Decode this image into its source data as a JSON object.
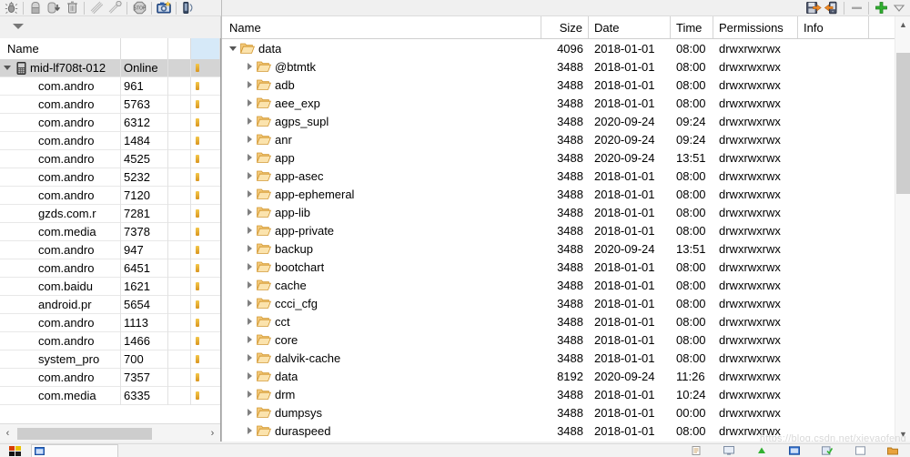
{
  "toolbar": {
    "left_buttons": [
      {
        "name": "debug-process-icon",
        "label": "Debug Process"
      },
      {
        "name": "update-heap-icon",
        "label": "Update Heap"
      },
      {
        "name": "dump-hprof-icon",
        "label": "Dump HPROF file"
      },
      {
        "name": "cause-gc-icon",
        "label": "Cause GC"
      },
      {
        "name": "update-threads-icon",
        "label": "Update Threads"
      },
      {
        "name": "start-method-profiling-icon",
        "label": "Start Method Profiling"
      },
      {
        "name": "stop-process-icon",
        "label": "Stop Process"
      },
      {
        "name": "screen-capture-icon",
        "label": "Screen Capture"
      },
      {
        "name": "device-panel-icon",
        "label": "Device Panel"
      }
    ],
    "right_buttons": [
      {
        "name": "pull-file-icon",
        "label": "Pull File from Device"
      },
      {
        "name": "push-file-icon",
        "label": "Push File onto Device"
      },
      {
        "name": "delete-icon",
        "label": "Delete"
      },
      {
        "name": "new-folder-icon",
        "label": "New Folder"
      },
      {
        "name": "view-menu-icon",
        "label": "View Menu"
      }
    ],
    "dropdown_name": "view-menu-caret"
  },
  "devices_panel": {
    "columns": [
      "Name",
      "",
      "",
      ""
    ],
    "device": {
      "name": "mid-lf708t-012",
      "status": "Online",
      "expanded": true
    },
    "processes": [
      {
        "name": "com.andro",
        "pid": "961"
      },
      {
        "name": "com.andro",
        "pid": "5763"
      },
      {
        "name": "com.andro",
        "pid": "6312"
      },
      {
        "name": "com.andro",
        "pid": "1484"
      },
      {
        "name": "com.andro",
        "pid": "4525"
      },
      {
        "name": "com.andro",
        "pid": "5232"
      },
      {
        "name": "com.andro",
        "pid": "7120"
      },
      {
        "name": "gzds.com.r",
        "pid": "7281"
      },
      {
        "name": "com.media",
        "pid": "7378"
      },
      {
        "name": "com.andro",
        "pid": "947"
      },
      {
        "name": "com.andro",
        "pid": "6451"
      },
      {
        "name": "com.baidu",
        "pid": "1621"
      },
      {
        "name": "android.pr",
        "pid": "5654"
      },
      {
        "name": "com.andro",
        "pid": "1113"
      },
      {
        "name": "com.andro",
        "pid": "1466"
      },
      {
        "name": "system_pro",
        "pid": "700"
      },
      {
        "name": "com.andro",
        "pid": "7357"
      },
      {
        "name": "com.media",
        "pid": "6335"
      }
    ],
    "hscrollbar": {
      "left_arrow": "‹",
      "right_arrow": "›"
    }
  },
  "file_explorer": {
    "columns": [
      "Name",
      "Size",
      "Date",
      "Time",
      "Permissions",
      "Info"
    ],
    "rows": [
      {
        "name": "data",
        "depth": 0,
        "expanded": true,
        "size": "4096",
        "date": "2018-01-01",
        "time": "08:00",
        "permissions": "drwxrwxrwx",
        "info": ""
      },
      {
        "name": "@btmtk",
        "depth": 1,
        "expanded": false,
        "size": "3488",
        "date": "2018-01-01",
        "time": "08:00",
        "permissions": "drwxrwxrwx",
        "info": ""
      },
      {
        "name": "adb",
        "depth": 1,
        "expanded": false,
        "size": "3488",
        "date": "2018-01-01",
        "time": "08:00",
        "permissions": "drwxrwxrwx",
        "info": ""
      },
      {
        "name": "aee_exp",
        "depth": 1,
        "expanded": false,
        "size": "3488",
        "date": "2018-01-01",
        "time": "08:00",
        "permissions": "drwxrwxrwx",
        "info": ""
      },
      {
        "name": "agps_supl",
        "depth": 1,
        "expanded": false,
        "size": "3488",
        "date": "2020-09-24",
        "time": "09:24",
        "permissions": "drwxrwxrwx",
        "info": ""
      },
      {
        "name": "anr",
        "depth": 1,
        "expanded": false,
        "size": "3488",
        "date": "2020-09-24",
        "time": "09:24",
        "permissions": "drwxrwxrwx",
        "info": ""
      },
      {
        "name": "app",
        "depth": 1,
        "expanded": false,
        "size": "3488",
        "date": "2020-09-24",
        "time": "13:51",
        "permissions": "drwxrwxrwx",
        "info": ""
      },
      {
        "name": "app-asec",
        "depth": 1,
        "expanded": false,
        "size": "3488",
        "date": "2018-01-01",
        "time": "08:00",
        "permissions": "drwxrwxrwx",
        "info": ""
      },
      {
        "name": "app-ephemeral",
        "depth": 1,
        "expanded": false,
        "size": "3488",
        "date": "2018-01-01",
        "time": "08:00",
        "permissions": "drwxrwxrwx",
        "info": ""
      },
      {
        "name": "app-lib",
        "depth": 1,
        "expanded": false,
        "size": "3488",
        "date": "2018-01-01",
        "time": "08:00",
        "permissions": "drwxrwxrwx",
        "info": ""
      },
      {
        "name": "app-private",
        "depth": 1,
        "expanded": false,
        "size": "3488",
        "date": "2018-01-01",
        "time": "08:00",
        "permissions": "drwxrwxrwx",
        "info": ""
      },
      {
        "name": "backup",
        "depth": 1,
        "expanded": false,
        "size": "3488",
        "date": "2020-09-24",
        "time": "13:51",
        "permissions": "drwxrwxrwx",
        "info": ""
      },
      {
        "name": "bootchart",
        "depth": 1,
        "expanded": false,
        "size": "3488",
        "date": "2018-01-01",
        "time": "08:00",
        "permissions": "drwxrwxrwx",
        "info": ""
      },
      {
        "name": "cache",
        "depth": 1,
        "expanded": false,
        "size": "3488",
        "date": "2018-01-01",
        "time": "08:00",
        "permissions": "drwxrwxrwx",
        "info": ""
      },
      {
        "name": "ccci_cfg",
        "depth": 1,
        "expanded": false,
        "size": "3488",
        "date": "2018-01-01",
        "time": "08:00",
        "permissions": "drwxrwxrwx",
        "info": ""
      },
      {
        "name": "cct",
        "depth": 1,
        "expanded": false,
        "size": "3488",
        "date": "2018-01-01",
        "time": "08:00",
        "permissions": "drwxrwxrwx",
        "info": ""
      },
      {
        "name": "core",
        "depth": 1,
        "expanded": false,
        "size": "3488",
        "date": "2018-01-01",
        "time": "08:00",
        "permissions": "drwxrwxrwx",
        "info": ""
      },
      {
        "name": "dalvik-cache",
        "depth": 1,
        "expanded": false,
        "size": "3488",
        "date": "2018-01-01",
        "time": "08:00",
        "permissions": "drwxrwxrwx",
        "info": ""
      },
      {
        "name": "data",
        "depth": 1,
        "expanded": false,
        "size": "8192",
        "date": "2020-09-24",
        "time": "11:26",
        "permissions": "drwxrwxrwx",
        "info": ""
      },
      {
        "name": "drm",
        "depth": 1,
        "expanded": false,
        "size": "3488",
        "date": "2018-01-01",
        "time": "10:24",
        "permissions": "drwxrwxrwx",
        "info": ""
      },
      {
        "name": "dumpsys",
        "depth": 1,
        "expanded": false,
        "size": "3488",
        "date": "2018-01-01",
        "time": "00:00",
        "permissions": "drwxrwxrwx",
        "info": ""
      },
      {
        "name": "duraspeed",
        "depth": 1,
        "expanded": false,
        "size": "3488",
        "date": "2018-01-01",
        "time": "08:00",
        "permissions": "drwxrwxrwx",
        "info": ""
      }
    ],
    "vscrollbar": {
      "up_arrow": "▲",
      "down_arrow": "▼"
    }
  },
  "watermark": {
    "text": "https://blog.csdn.net/xieyaofeng"
  },
  "colors": {
    "folder": "#e8a33d",
    "selection": "#d6e9f8",
    "device_row": "#d4d4d4",
    "accent_green": "#31b131"
  }
}
